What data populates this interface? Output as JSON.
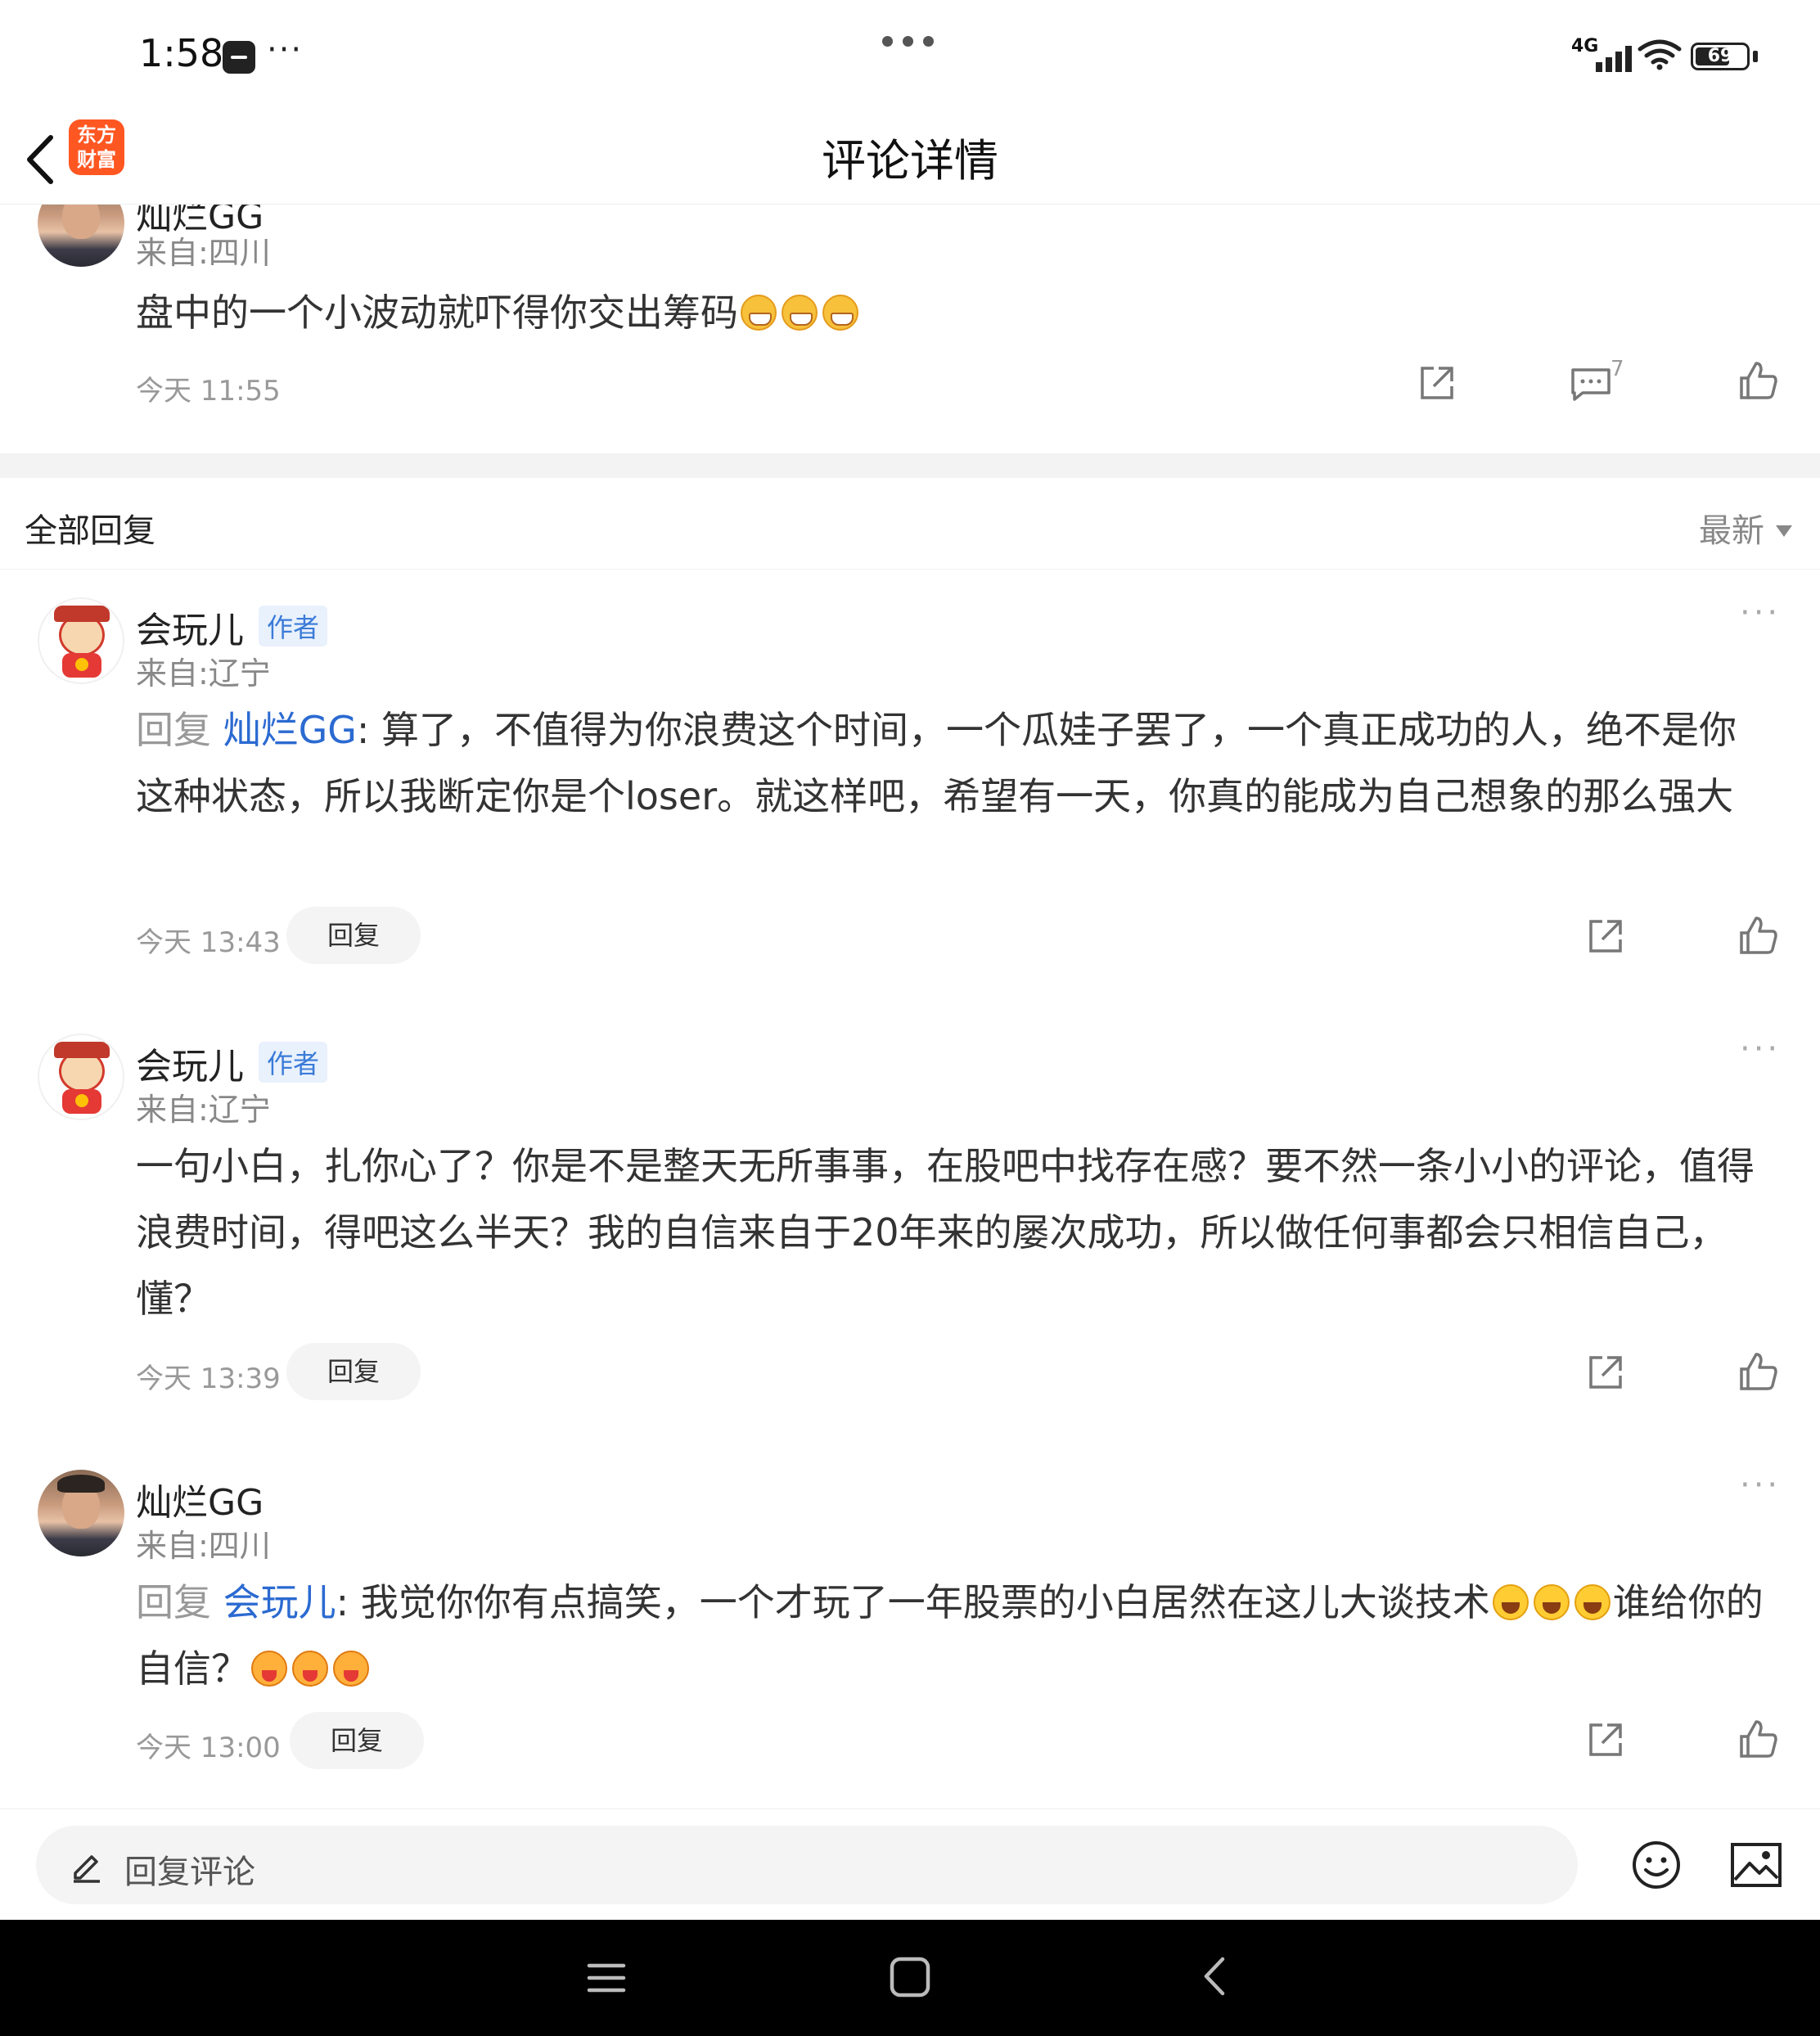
{
  "status_bar": {
    "time": "1:58",
    "more": "···",
    "network": "4G",
    "battery": "69",
    "battery_level": 0.69
  },
  "header": {
    "title": "评论详情",
    "logo_line1": "东方",
    "logo_line2": "财富"
  },
  "main_comment": {
    "user": "灿烂GG",
    "location": "来自:四川",
    "text": "盘中的一个小波动就吓得你交出筹码",
    "emojis": [
      "grin",
      "grin",
      "grin"
    ],
    "time": "今天 11:55",
    "comment_count": "7"
  },
  "replies_section": {
    "title": "全部回复",
    "sort": "最新"
  },
  "replies": [
    {
      "user": "会玩儿",
      "badge": "作者",
      "location": "来自:辽宁",
      "reply_prefix": "回复 ",
      "mention": "灿烂GG",
      "text": ": 算了，不值得为你浪费这个时间，一个瓜娃子罢了，一个真正成功的人，绝不是你这种状态，所以我断定你是个loser。就这样吧，希望有一天，你真的能成为自己想象的那么强大",
      "time": "今天 13:43",
      "reply_label": "回复"
    },
    {
      "user": "会玩儿",
      "badge": "作者",
      "location": "来自:辽宁",
      "text": "一句小白，扎你心了？你是不是整天无所事事，在股吧中找存在感？要不然一条小小的评论，值得浪费时间，得吧这么半天？我的自信来自于20年来的屡次成功，所以做任何事都会只相信自己，懂？",
      "time": "今天 13:39",
      "reply_label": "回复"
    },
    {
      "user": "灿烂GG",
      "location": "来自:四川",
      "reply_prefix": "回复 ",
      "mention": "会玩儿",
      "text_part1": ": 我觉你你有点搞笑，一个才玩了一年股票的小白居然在这儿大谈技术",
      "text_part2": "谁给你的自信？",
      "emojis_mid": [
        "laugh",
        "laugh",
        "laugh"
      ],
      "emojis_end": [
        "tongue",
        "tongue",
        "tongue"
      ],
      "time": "今天 13:00",
      "reply_label": "回复"
    }
  ],
  "input_bar": {
    "placeholder": "回复评论"
  },
  "colors": {
    "mention": "#2b6ad1",
    "badge_text": "#3b7bd8",
    "badge_bg": "#e8f1fc",
    "logo": "#ff5722"
  }
}
